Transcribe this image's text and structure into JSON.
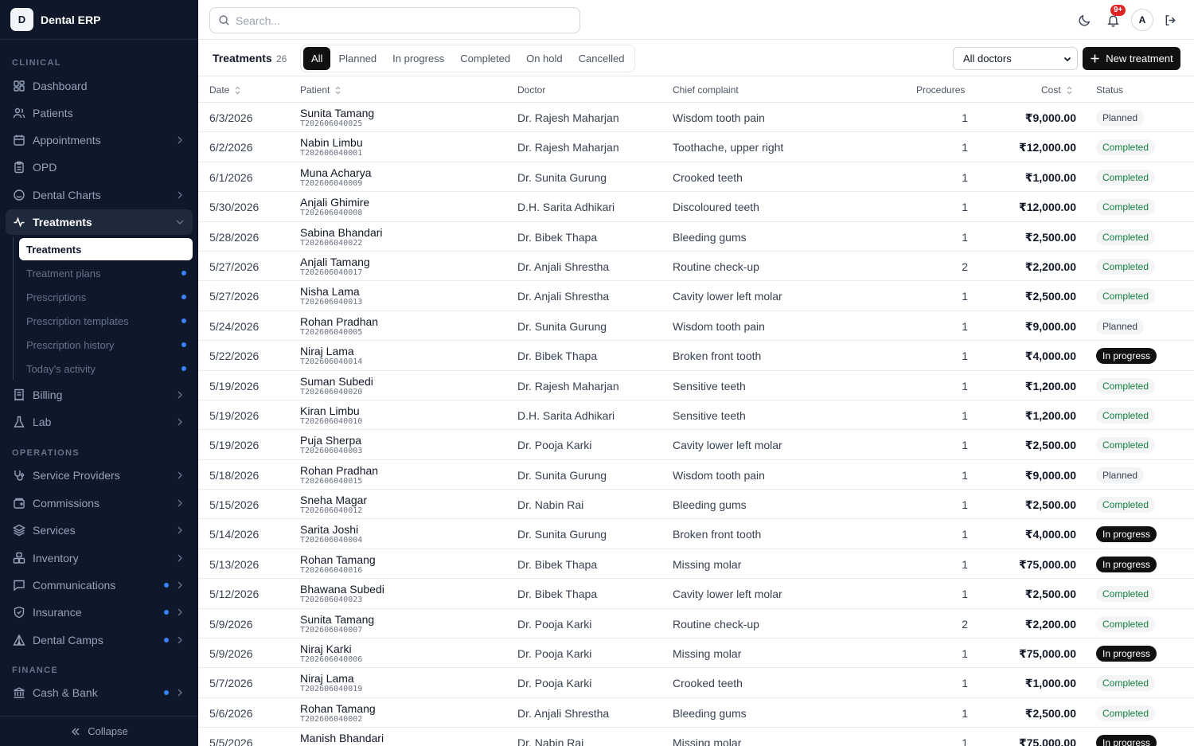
{
  "app": {
    "logo_letter": "D",
    "name": "Dental ERP"
  },
  "sidebar": {
    "sections": [
      "CLINICAL",
      "OPERATIONS",
      "FINANCE"
    ],
    "items": [
      {
        "label": "Dashboard",
        "icon": "dashboard-icon"
      },
      {
        "label": "Patients",
        "icon": "users-icon"
      },
      {
        "label": "Appointments",
        "icon": "calendar-icon"
      },
      {
        "label": "OPD",
        "icon": "clipboard-icon"
      },
      {
        "label": "Dental Charts",
        "icon": "chart-circle-icon"
      },
      {
        "label": "Treatments",
        "icon": "activity-icon"
      },
      {
        "label": "Billing",
        "icon": "receipt-icon"
      },
      {
        "label": "Lab",
        "icon": "flask-icon"
      },
      {
        "label": "Service Providers",
        "icon": "stethoscope-icon"
      },
      {
        "label": "Commissions",
        "icon": "wallet-icon"
      },
      {
        "label": "Services",
        "icon": "layers-icon"
      },
      {
        "label": "Inventory",
        "icon": "boxes-icon"
      },
      {
        "label": "Communications",
        "icon": "message-icon"
      },
      {
        "label": "Insurance",
        "icon": "shield-icon"
      },
      {
        "label": "Dental Camps",
        "icon": "tent-icon"
      },
      {
        "label": "Cash & Bank",
        "icon": "bank-icon"
      }
    ],
    "sub_items": [
      "Treatments",
      "Treatment plans",
      "Prescriptions",
      "Prescription templates",
      "Prescription history",
      "Today's activity"
    ],
    "collapse_label": "Collapse"
  },
  "topbar": {
    "search_placeholder": "Search...",
    "notification_badge": "9+",
    "avatar_letter": "A"
  },
  "toolbar": {
    "title": "Treatments",
    "count": "26",
    "tabs": [
      "All",
      "Planned",
      "In progress",
      "Completed",
      "On hold",
      "Cancelled"
    ],
    "active_tab": "All",
    "doctor_filter": "All doctors",
    "new_button": "New treatment"
  },
  "table": {
    "columns": [
      "Date",
      "Patient",
      "Doctor",
      "Chief complaint",
      "Procedures",
      "Cost",
      "Status"
    ],
    "rows": [
      {
        "date": "6/3/2026",
        "patient": "Sunita Tamang",
        "pid": "T202606040025",
        "doctor": "Dr. Rajesh Maharjan",
        "complaint": "Wisdom tooth pain",
        "procedures": "1",
        "cost": "₹9,000.00",
        "status": "Planned"
      },
      {
        "date": "6/2/2026",
        "patient": "Nabin Limbu",
        "pid": "T202606040001",
        "doctor": "Dr. Rajesh Maharjan",
        "complaint": "Toothache, upper right",
        "procedures": "1",
        "cost": "₹12,000.00",
        "status": "Completed"
      },
      {
        "date": "6/1/2026",
        "patient": "Muna Acharya",
        "pid": "T202606040009",
        "doctor": "Dr. Sunita Gurung",
        "complaint": "Crooked teeth",
        "procedures": "1",
        "cost": "₹1,000.00",
        "status": "Completed"
      },
      {
        "date": "5/30/2026",
        "patient": "Anjali Ghimire",
        "pid": "T202606040008",
        "doctor": "D.H. Sarita Adhikari",
        "complaint": "Discoloured teeth",
        "procedures": "1",
        "cost": "₹12,000.00",
        "status": "Completed"
      },
      {
        "date": "5/28/2026",
        "patient": "Sabina Bhandari",
        "pid": "T202606040022",
        "doctor": "Dr. Bibek Thapa",
        "complaint": "Bleeding gums",
        "procedures": "1",
        "cost": "₹2,500.00",
        "status": "Completed"
      },
      {
        "date": "5/27/2026",
        "patient": "Anjali Tamang",
        "pid": "T202606040017",
        "doctor": "Dr. Anjali Shrestha",
        "complaint": "Routine check-up",
        "procedures": "2",
        "cost": "₹2,200.00",
        "status": "Completed"
      },
      {
        "date": "5/27/2026",
        "patient": "Nisha Lama",
        "pid": "T202606040013",
        "doctor": "Dr. Anjali Shrestha",
        "complaint": "Cavity lower left molar",
        "procedures": "1",
        "cost": "₹2,500.00",
        "status": "Completed"
      },
      {
        "date": "5/24/2026",
        "patient": "Rohan Pradhan",
        "pid": "T202606040005",
        "doctor": "Dr. Sunita Gurung",
        "complaint": "Wisdom tooth pain",
        "procedures": "1",
        "cost": "₹9,000.00",
        "status": "Planned"
      },
      {
        "date": "5/22/2026",
        "patient": "Niraj Lama",
        "pid": "T202606040014",
        "doctor": "Dr. Bibek Thapa",
        "complaint": "Broken front tooth",
        "procedures": "1",
        "cost": "₹4,000.00",
        "status": "In progress"
      },
      {
        "date": "5/19/2026",
        "patient": "Suman Subedi",
        "pid": "T202606040020",
        "doctor": "Dr. Rajesh Maharjan",
        "complaint": "Sensitive teeth",
        "procedures": "1",
        "cost": "₹1,200.00",
        "status": "Completed"
      },
      {
        "date": "5/19/2026",
        "patient": "Kiran Limbu",
        "pid": "T202606040010",
        "doctor": "D.H. Sarita Adhikari",
        "complaint": "Sensitive teeth",
        "procedures": "1",
        "cost": "₹1,200.00",
        "status": "Completed"
      },
      {
        "date": "5/19/2026",
        "patient": "Puja Sherpa",
        "pid": "T202606040003",
        "doctor": "Dr. Pooja Karki",
        "complaint": "Cavity lower left molar",
        "procedures": "1",
        "cost": "₹2,500.00",
        "status": "Completed"
      },
      {
        "date": "5/18/2026",
        "patient": "Rohan Pradhan",
        "pid": "T202606040015",
        "doctor": "Dr. Sunita Gurung",
        "complaint": "Wisdom tooth pain",
        "procedures": "1",
        "cost": "₹9,000.00",
        "status": "Planned"
      },
      {
        "date": "5/15/2026",
        "patient": "Sneha Magar",
        "pid": "T202606040012",
        "doctor": "Dr. Nabin Rai",
        "complaint": "Bleeding gums",
        "procedures": "1",
        "cost": "₹2,500.00",
        "status": "Completed"
      },
      {
        "date": "5/14/2026",
        "patient": "Sarita Joshi",
        "pid": "T202606040004",
        "doctor": "Dr. Sunita Gurung",
        "complaint": "Broken front tooth",
        "procedures": "1",
        "cost": "₹4,000.00",
        "status": "In progress"
      },
      {
        "date": "5/13/2026",
        "patient": "Rohan Tamang",
        "pid": "T202606040016",
        "doctor": "Dr. Bibek Thapa",
        "complaint": "Missing molar",
        "procedures": "1",
        "cost": "₹75,000.00",
        "status": "In progress"
      },
      {
        "date": "5/12/2026",
        "patient": "Bhawana Subedi",
        "pid": "T202606040023",
        "doctor": "Dr. Bibek Thapa",
        "complaint": "Cavity lower left molar",
        "procedures": "1",
        "cost": "₹2,500.00",
        "status": "Completed"
      },
      {
        "date": "5/9/2026",
        "patient": "Sunita Tamang",
        "pid": "T202606040007",
        "doctor": "Dr. Pooja Karki",
        "complaint": "Routine check-up",
        "procedures": "2",
        "cost": "₹2,200.00",
        "status": "Completed"
      },
      {
        "date": "5/9/2026",
        "patient": "Niraj Karki",
        "pid": "T202606040006",
        "doctor": "Dr. Pooja Karki",
        "complaint": "Missing molar",
        "procedures": "1",
        "cost": "₹75,000.00",
        "status": "In progress"
      },
      {
        "date": "5/7/2026",
        "patient": "Niraj Lama",
        "pid": "T202606040019",
        "doctor": "Dr. Pooja Karki",
        "complaint": "Crooked teeth",
        "procedures": "1",
        "cost": "₹1,000.00",
        "status": "Completed"
      },
      {
        "date": "5/6/2026",
        "patient": "Rohan Tamang",
        "pid": "T202606040002",
        "doctor": "Dr. Anjali Shrestha",
        "complaint": "Bleeding gums",
        "procedures": "1",
        "cost": "₹2,500.00",
        "status": "Completed"
      },
      {
        "date": "5/5/2026",
        "patient": "Manish Bhandari",
        "pid": "",
        "doctor": "Dr. Nabin Rai",
        "complaint": "Missing molar",
        "procedures": "1",
        "cost": "₹75,000.00",
        "status": "In progress"
      }
    ]
  }
}
